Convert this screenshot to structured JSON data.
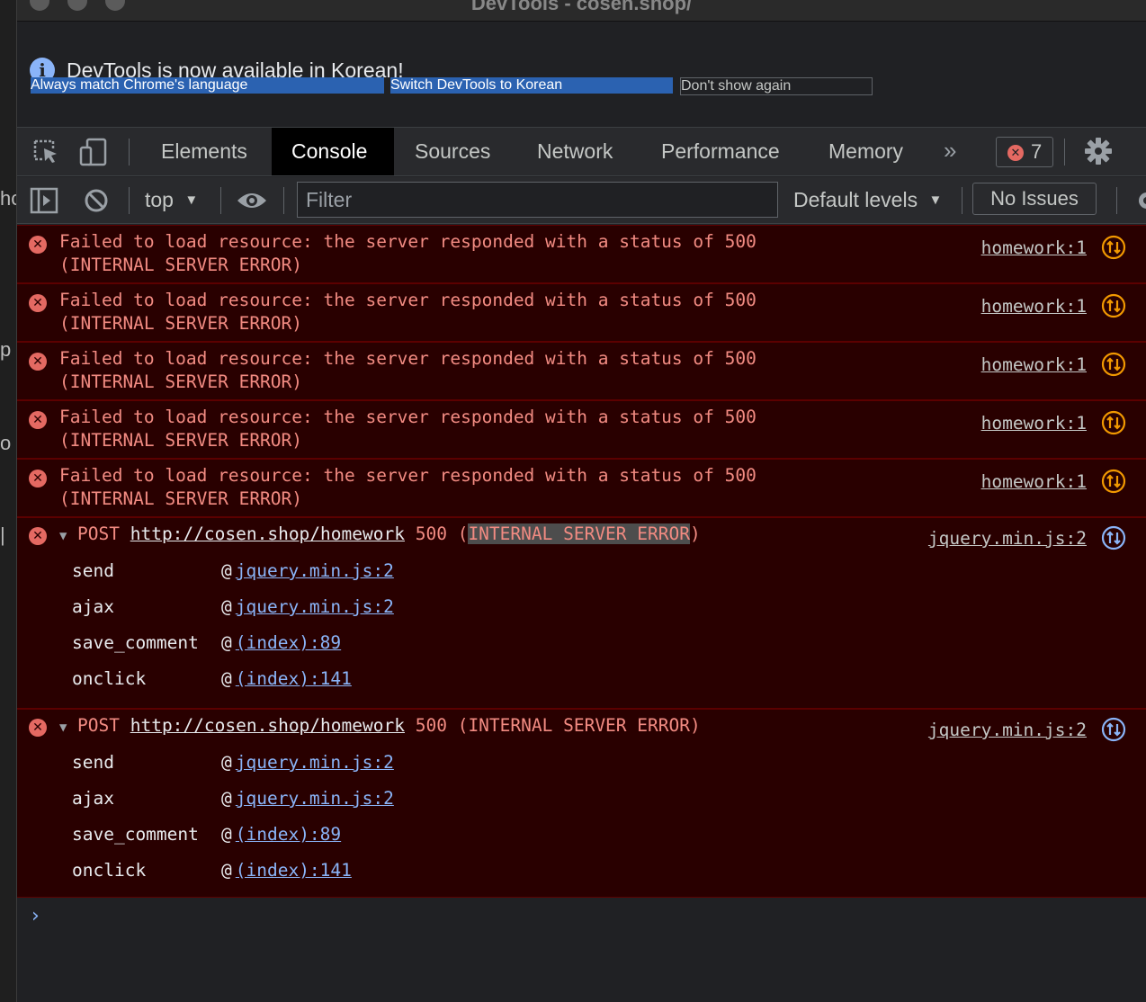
{
  "window": {
    "title": "DevTools - cosen.shop/"
  },
  "infobar": {
    "message": "DevTools is now available in Korean!",
    "buttons": [
      "Always match Chrome's language",
      "Switch DevTools to Korean",
      "Don't show again"
    ]
  },
  "tabs": [
    "Elements",
    "Console",
    "Sources",
    "Network",
    "Performance",
    "Memory"
  ],
  "active_tab": "Console",
  "error_count": "7",
  "filterbar": {
    "context": "top",
    "filter_placeholder": "Filter",
    "levels": "Default levels",
    "issues": "No Issues"
  },
  "console": {
    "simple_errors": [
      {
        "line1": "Failed to load resource: the server responded with a status of 500",
        "line2": "(INTERNAL SERVER ERROR)",
        "source": "homework:1"
      },
      {
        "line1": "Failed to load resource: the server responded with a status of 500",
        "line2": "(INTERNAL SERVER ERROR)",
        "source": "homework:1"
      },
      {
        "line1": "Failed to load resource: the server responded with a status of 500",
        "line2": "(INTERNAL SERVER ERROR)",
        "source": "homework:1"
      },
      {
        "line1": "Failed to load resource: the server responded with a status of 500",
        "line2": "(INTERNAL SERVER ERROR)",
        "source": "homework:1"
      },
      {
        "line1": "Failed to load resource: the server responded with a status of 500",
        "line2": "(INTERNAL SERVER ERROR)",
        "source": "homework:1"
      }
    ],
    "xhr_errors": [
      {
        "method": "POST",
        "url": "http://cosen.shop/homework",
        "status": "500",
        "status_text": "INTERNAL SERVER ERROR",
        "source": "jquery.min.js:2",
        "stack": [
          {
            "fn": "send",
            "loc": "jquery.min.js:2"
          },
          {
            "fn": "ajax",
            "loc": "jquery.min.js:2"
          },
          {
            "fn": "save_comment",
            "loc": "(index):89"
          },
          {
            "fn": "onclick",
            "loc": "(index):141"
          }
        ]
      },
      {
        "method": "POST",
        "url": "http://cosen.shop/homework",
        "status": "500",
        "status_text": "INTERNAL SERVER ERROR",
        "source": "jquery.min.js:2",
        "stack": [
          {
            "fn": "send",
            "loc": "jquery.min.js:2"
          },
          {
            "fn": "ajax",
            "loc": "jquery.min.js:2"
          },
          {
            "fn": "save_comment",
            "loc": "(index):89"
          },
          {
            "fn": "onclick",
            "loc": "(index):141"
          }
        ]
      }
    ]
  },
  "colors": {
    "error_bg": "#290000",
    "error_text": "#f28b82",
    "link_blue": "#8ab4f8",
    "primary_button": "#2b62b1"
  }
}
